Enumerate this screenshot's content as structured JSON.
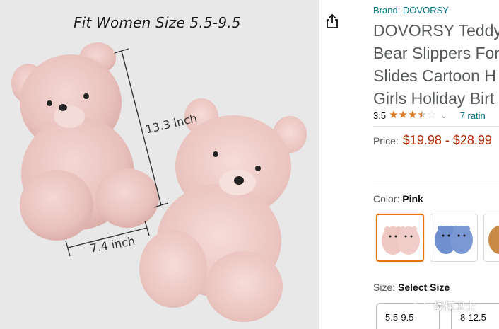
{
  "image": {
    "fit_text": "Fit Women Size 5.5-9.5",
    "height_label": "13.3 inch",
    "width_label": "7.4 inch"
  },
  "share": {
    "icon": "share-icon"
  },
  "product": {
    "brand": "Brand: DOVORSY",
    "title_lines": [
      "DOVORSY Teddy",
      "Bear Slippers For",
      "Slides Cartoon H",
      "Girls Holiday Birt"
    ],
    "rating_value": "3.5",
    "rating_fraction": 0.7,
    "ratings_count": "7 ratin",
    "price_label": "Price:",
    "price_range": "$19.98 - $28.99",
    "color_label": "Color:",
    "color_value": "Pink",
    "size_label": "Size:",
    "size_value": "Select Size",
    "sizes": [
      "5.5-9.5",
      "8-12.5"
    ]
  },
  "colors": {
    "link": "#007185",
    "price": "#b12704",
    "star": "#de7921",
    "selected_border": "#e77600"
  },
  "watermark": {
    "text": "侵权卫士"
  }
}
